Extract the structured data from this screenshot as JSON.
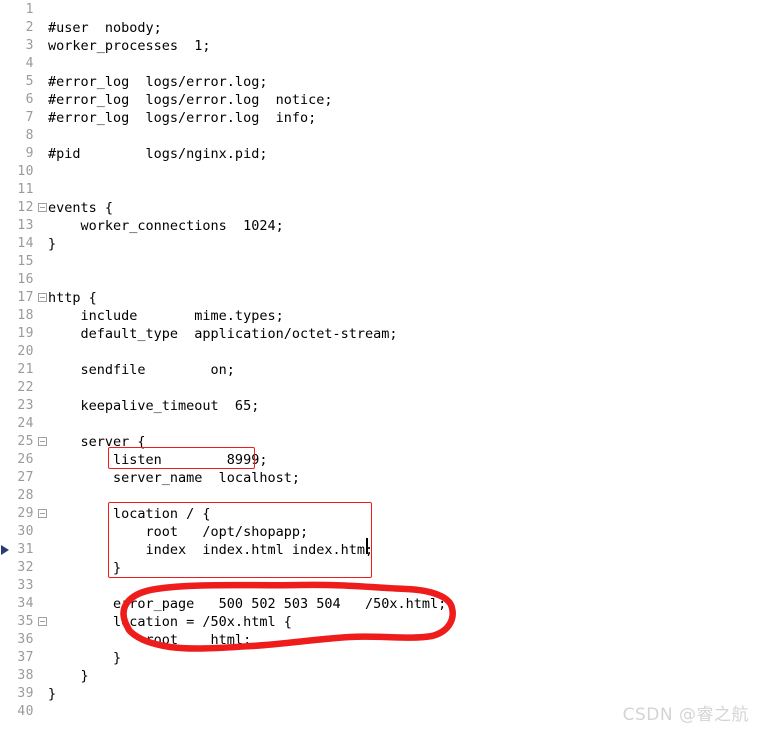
{
  "editor": {
    "first_line": 1,
    "last_line": 40,
    "caret_line": 31,
    "execution_pointer_line": 31,
    "lines": [
      {
        "n": 1,
        "text": ""
      },
      {
        "n": 2,
        "text": "#user  nobody;"
      },
      {
        "n": 3,
        "text": "worker_processes  1;"
      },
      {
        "n": 4,
        "text": ""
      },
      {
        "n": 5,
        "text": "#error_log  logs/error.log;"
      },
      {
        "n": 6,
        "text": "#error_log  logs/error.log  notice;"
      },
      {
        "n": 7,
        "text": "#error_log  logs/error.log  info;"
      },
      {
        "n": 8,
        "text": ""
      },
      {
        "n": 9,
        "text": "#pid        logs/nginx.pid;"
      },
      {
        "n": 10,
        "text": ""
      },
      {
        "n": 11,
        "text": ""
      },
      {
        "n": 12,
        "text": "events {",
        "fold": true
      },
      {
        "n": 13,
        "text": "    worker_connections  1024;"
      },
      {
        "n": 14,
        "text": "}"
      },
      {
        "n": 15,
        "text": ""
      },
      {
        "n": 16,
        "text": ""
      },
      {
        "n": 17,
        "text": "http {",
        "fold": true
      },
      {
        "n": 18,
        "text": "    include       mime.types;"
      },
      {
        "n": 19,
        "text": "    default_type  application/octet-stream;"
      },
      {
        "n": 20,
        "text": ""
      },
      {
        "n": 21,
        "text": "    sendfile        on;"
      },
      {
        "n": 22,
        "text": ""
      },
      {
        "n": 23,
        "text": "    keepalive_timeout  65;"
      },
      {
        "n": 24,
        "text": ""
      },
      {
        "n": 25,
        "text": "    server {",
        "fold": true
      },
      {
        "n": 26,
        "text": "        listen        8999;"
      },
      {
        "n": 27,
        "text": "        server_name  localhost;"
      },
      {
        "n": 28,
        "text": ""
      },
      {
        "n": 29,
        "text": "        location / {",
        "fold": true
      },
      {
        "n": 30,
        "text": "            root   /opt/shopapp;"
      },
      {
        "n": 31,
        "text": "            index  index.html index.htm;",
        "pointer": true
      },
      {
        "n": 32,
        "text": "        }"
      },
      {
        "n": 33,
        "text": ""
      },
      {
        "n": 34,
        "text": "        error_page   500 502 503 504   /50x.html;"
      },
      {
        "n": 35,
        "text": "        location = /50x.html {",
        "fold": true
      },
      {
        "n": 36,
        "text": "            root    html;"
      },
      {
        "n": 37,
        "text": "        }"
      },
      {
        "n": 38,
        "text": "    }"
      },
      {
        "n": 39,
        "text": "}"
      },
      {
        "n": 40,
        "text": ""
      }
    ]
  },
  "annotations": {
    "color": "#ef1c1c",
    "listen_box": {
      "label": "listen 8999; highlight rectangle"
    },
    "location_box": {
      "label": "location / block highlight rectangle"
    },
    "error_page_ellipse": {
      "label": "error_page / location = /50x.html hand-drawn ellipse"
    }
  },
  "watermark": {
    "text": "CSDN @睿之航",
    "color": "#d4d4d4"
  }
}
